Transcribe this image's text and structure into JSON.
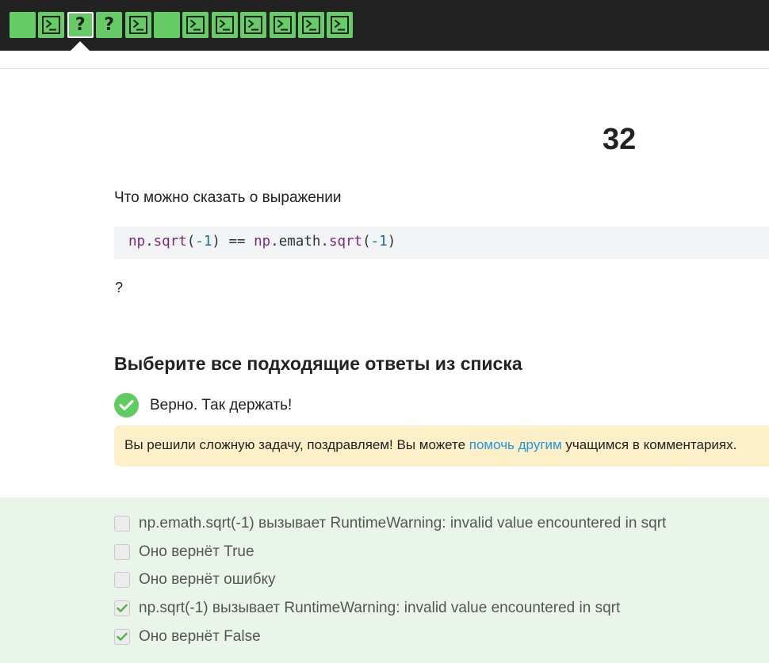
{
  "steps": [
    {
      "type": "filled",
      "icon": "blank-step-icon",
      "active": false
    },
    {
      "type": "code",
      "icon": "terminal-icon",
      "active": false
    },
    {
      "type": "quiz",
      "icon": "question-icon",
      "label": "?",
      "active": true
    },
    {
      "type": "quiz",
      "icon": "question-icon",
      "label": "?",
      "active": false
    },
    {
      "type": "code",
      "icon": "terminal-icon",
      "active": false
    },
    {
      "type": "filled",
      "icon": "blank-step-icon",
      "active": false
    },
    {
      "type": "code",
      "icon": "terminal-icon",
      "active": false
    },
    {
      "type": "code",
      "icon": "terminal-icon",
      "active": false
    },
    {
      "type": "code",
      "icon": "terminal-icon",
      "active": false
    },
    {
      "type": "code",
      "icon": "terminal-icon",
      "active": false
    },
    {
      "type": "code",
      "icon": "terminal-icon",
      "active": false
    },
    {
      "type": "code",
      "icon": "terminal-icon",
      "active": false
    }
  ],
  "step_number": "32",
  "question": {
    "text": "Что можно сказать о выражении",
    "code_tokens": [
      {
        "t": "np",
        "c": "var"
      },
      {
        "t": ".",
        "c": "plain"
      },
      {
        "t": "sqrt",
        "c": "var"
      },
      {
        "t": "(",
        "c": "plain"
      },
      {
        "t": "-1",
        "c": "num"
      },
      {
        "t": ") == ",
        "c": "plain"
      },
      {
        "t": "np",
        "c": "var"
      },
      {
        "t": ".emath.",
        "c": "plain"
      },
      {
        "t": "sqrt",
        "c": "var"
      },
      {
        "t": "(",
        "c": "plain"
      },
      {
        "t": "-1",
        "c": "num"
      },
      {
        "t": ")",
        "c": "plain"
      }
    ],
    "trailing": "?"
  },
  "task_heading": "Выберите все подходящие ответы из списка",
  "feedback": {
    "icon": "check-circle-icon",
    "text": "Верно. Так держать!",
    "color": "#5fcc5f"
  },
  "hint": {
    "before": "Вы решили сложную задачу, поздравляем! Вы можете ",
    "link": "помочь другим",
    "after": " учащимся в комментариях."
  },
  "options": [
    {
      "label": "np.emath.sqrt(-1) вызывает RuntimeWarning: invalid value encountered in sqrt",
      "checked": false
    },
    {
      "label": "Оно вернёт True",
      "checked": false
    },
    {
      "label": "Оно вернёт ошибку",
      "checked": false
    },
    {
      "label": "np.sqrt(-1) вызывает RuntimeWarning: invalid value encountered in sqrt",
      "checked": true
    },
    {
      "label": "Оно вернёт False",
      "checked": true
    }
  ],
  "colors": {
    "topbar": "#222222",
    "step_green": "#66cc66",
    "answers_bg": "#e8f5e8",
    "hint_bg": "#fdefc7",
    "link": "#2196e0"
  }
}
